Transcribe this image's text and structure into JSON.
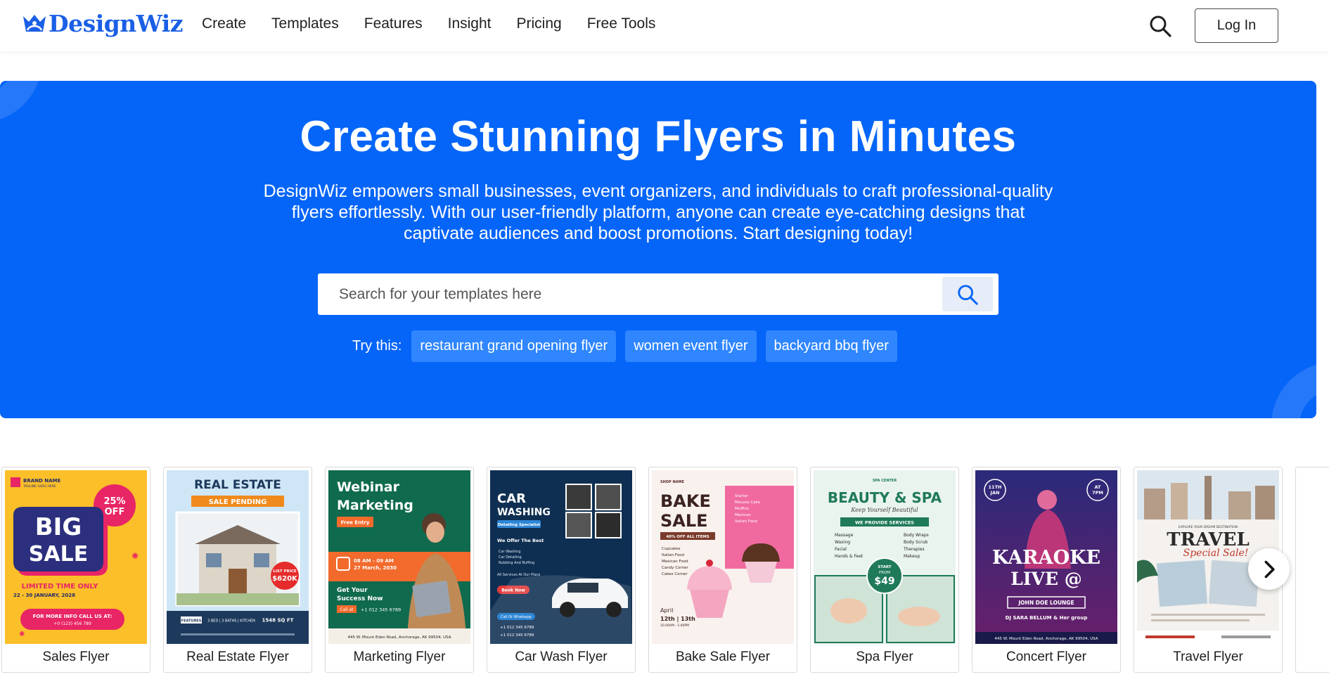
{
  "brand": {
    "name": "DesignWiz",
    "color": "#1a5fe6"
  },
  "nav": {
    "items": [
      {
        "label": "Create"
      },
      {
        "label": "Templates"
      },
      {
        "label": "Features"
      },
      {
        "label": "Insight"
      },
      {
        "label": "Pricing"
      },
      {
        "label": "Free Tools"
      }
    ],
    "search_icon": "search-icon",
    "login_label": "Log In"
  },
  "hero": {
    "background": "#0565f8",
    "title": "Create Stunning Flyers in Minutes",
    "description": "DesignWiz empowers small businesses, event organizers, and individuals to craft professional-quality flyers effortlessly. With our user-friendly platform, anyone can create eye-catching designs that captivate audiences and boost promotions. Start designing today!",
    "search": {
      "placeholder": "Search for your templates here",
      "value": ""
    },
    "try_label": "Try this:",
    "suggestions": [
      {
        "label": "restaurant grand opening flyer"
      },
      {
        "label": "women event flyer"
      },
      {
        "label": "backyard bbq flyer"
      }
    ]
  },
  "templates": {
    "items": [
      {
        "label": "Sales Flyer",
        "art": {
          "brand": "BRAND NAME",
          "tag": "TAGLINE GOES HERE",
          "badge_top": "25%",
          "badge_bottom": "OFF",
          "headline_1": "BIG",
          "headline_2": "SALE",
          "line_1": "LIMITED TIME ONLY",
          "line_2": "22 - 30 JANUARY, 2028",
          "cta": "FOR MORE INFO CALL US AT:",
          "phone": "+0 (123) 456 789"
        }
      },
      {
        "label": "Real Estate Flyer",
        "art": {
          "headline": "REAL ESTATE",
          "ribbon": "SALE PENDING",
          "price_label": "LIST PRICE",
          "price": "$620K",
          "features": "FEATURES",
          "rooms": "3 BED | 3 BATHS | KITCHEN",
          "sqft": "1548 SQ FT"
        }
      },
      {
        "label": "Marketing Flyer",
        "art": {
          "headline_1": "Webinar",
          "headline_2": "Marketing",
          "tag": "Free Entry",
          "date_1": "08 AM - 09 AM",
          "date_2": "27 March, 2030",
          "cta_1": "Get Your",
          "cta_2": "Success Now",
          "call": "Call at",
          "phone": "+1 012 345 6789",
          "address": "445 W. Mount Eden Road, Anchorage, AK 99504, USA"
        }
      },
      {
        "label": "Car Wash Flyer",
        "art": {
          "headline_1": "CAR",
          "headline_2": "WASHING",
          "tag": "Detailing Specialist",
          "offer": "We Offer The Best",
          "list": [
            "Car Washing",
            "Car Detailing",
            "Rubbing And Buffing"
          ],
          "services": "All Services At Our Place",
          "cta": "Book Now",
          "whatsapp": "Call Or Whatsapp",
          "phone_1": "+1 012 345 6789",
          "phone_2": "+1 012 345 6789"
        }
      },
      {
        "label": "Bake Sale Flyer",
        "art": {
          "shop": "SHOP NAME",
          "headline_1": "BAKE",
          "headline_2": "SALE",
          "discount": "40% OFF ALL ITEMS",
          "items": [
            "Cupcakes",
            "Italian Food",
            "Mexican Food",
            "Candy Corner",
            "Cakes Corner"
          ],
          "pink_items": [
            "Starter",
            "Mousse Cake",
            "Muffins",
            "Mexican",
            "Italian Food"
          ],
          "month": "April",
          "dates": "12th | 13th",
          "time": "10.00AM - 5.00PM"
        }
      },
      {
        "label": "Spa Flyer",
        "art": {
          "center": "SPA CENTER",
          "headline": "BEAUTY & SPA",
          "script": "Keep Yourself Beautiful",
          "ribbon": "WE PROVIDE SERVICES",
          "left": [
            "Massage",
            "Waxing",
            "Facial",
            "Hands & Feet"
          ],
          "right": [
            "Body Wraps",
            "Body Scrub",
            "Therapies",
            "Makeup"
          ],
          "start": "START",
          "from": "FROM",
          "price": "$49"
        }
      },
      {
        "label": "Concert Flyer",
        "art": {
          "date_1": "11TH",
          "date_2": "JAN",
          "time_1": "AT",
          "time_2": "7PM",
          "headline_1": "KARAOKE",
          "headline_2": "LIVE @",
          "venue": "JOHN DOE LOUNGE",
          "host": "DJ SARA BELLUM & Her group",
          "address": "445 W. Mount Eden Road, Anchorage, AK 99504, USA"
        }
      },
      {
        "label": "Travel Flyer",
        "art": {
          "kicker": "EXPLORE YOUR DREAM DESTINATION",
          "headline": "TRAVEL",
          "script": "Special Sale!"
        }
      }
    ],
    "next_icon": "chevron-right-icon"
  }
}
